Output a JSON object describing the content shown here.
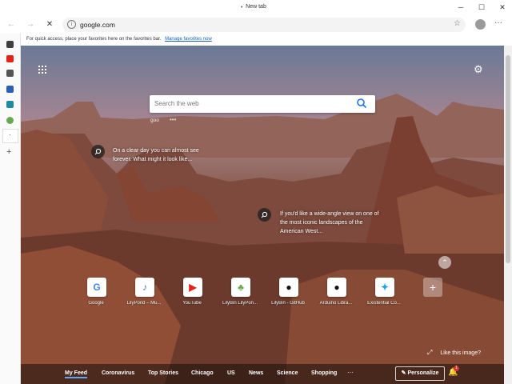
{
  "window": {
    "title": "New tab",
    "title_dot": "•",
    "minimize": "─",
    "maximize": "☐",
    "close": "✕"
  },
  "toolbar": {
    "back_icon": "←",
    "forward_icon": "→",
    "stop_icon": "✕",
    "url": "google.com",
    "info_icon": "i",
    "favorite_icon": "☆",
    "more_icon": "···"
  },
  "favorites_bar": {
    "message": "For quick access, place your favorites here on the favorites bar.",
    "link": "Manage favorites now"
  },
  "sidebar": {
    "items": [
      {
        "name": "sidebar-item-1",
        "color": "#404040"
      },
      {
        "name": "sidebar-item-youtube",
        "color": "#e62117"
      },
      {
        "name": "sidebar-item-speaker",
        "color": "#555555"
      },
      {
        "name": "sidebar-item-doc",
        "color": "#2b5fb8"
      },
      {
        "name": "sidebar-item-image",
        "color": "#1f8b9b"
      },
      {
        "name": "sidebar-item-lilypond",
        "color": "#6aa84f"
      },
      {
        "name": "sidebar-item-active",
        "color": "#333333"
      }
    ],
    "add_icon": "+"
  },
  "newtab": {
    "search_placeholder": "Search the web",
    "suggestion": "goo",
    "suggestion_dots": "•••",
    "settings_icon": "⚙",
    "hints": [
      {
        "text_line1": "On a clear day you can almost see",
        "text_line2": "forever. What might it look like..."
      },
      {
        "text_line1": "If you'd like a wide-angle view on one of",
        "text_line2": "the most iconic landscapes of the",
        "text_line3": "American West..."
      }
    ],
    "collapse_icon": "⌃",
    "tiles": [
      {
        "label": "Google",
        "glyph": "G",
        "color": "#4285f4"
      },
      {
        "label": "LilyPond – Mu...",
        "glyph": "♪",
        "color": "#3d7ab8"
      },
      {
        "label": "YouTube",
        "glyph": "▶",
        "color": "#e62117"
      },
      {
        "label": "LilyBin LilyPon...",
        "glyph": "♣",
        "color": "#6aa84f"
      },
      {
        "label": "LilyBin - GitHub",
        "glyph": "●",
        "color": "#111111"
      },
      {
        "label": "Arduino Libra...",
        "glyph": "●",
        "color": "#111111"
      },
      {
        "label": "Existential Co...",
        "glyph": "✦",
        "color": "#1da1f2"
      },
      {
        "label": "",
        "glyph": "+",
        "color": "#ffffff"
      }
    ],
    "like_text": "Like this image?",
    "like_arrow": "⤢"
  },
  "feed": {
    "items": [
      "My Feed",
      "Coronavirus",
      "Top Stories",
      "Chicago",
      "US",
      "News",
      "Science",
      "Shopping"
    ],
    "more": "···",
    "personalize": "✎ Personalize",
    "bell_icon": "🔔",
    "badge": "1"
  }
}
